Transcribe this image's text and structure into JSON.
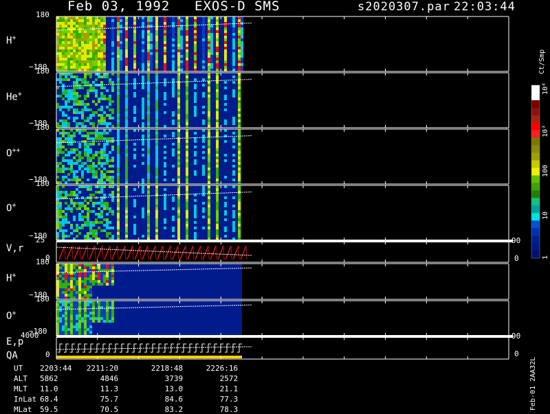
{
  "header": {
    "date": "Feb 03, 1992",
    "instrument": "EXOS-D SMS",
    "file": "s2020307.par",
    "time": "22:03:44"
  },
  "panels": [
    {
      "label": "H",
      "sup": "+",
      "ytop": "180",
      "ybot": "−180"
    },
    {
      "label": "He",
      "sup": "+",
      "ytop": "180",
      "ybot": "−180"
    },
    {
      "label": "O",
      "sup": "++",
      "ytop": "180",
      "ybot": "−180"
    },
    {
      "label": "O",
      "sup": "+",
      "ytop": "180",
      "ybot": "−180"
    },
    {
      "label": "V,r",
      "sup": "",
      "ytop": "25",
      "ybot": "0",
      "rtop": "90",
      "rbot": "0"
    },
    {
      "label": "H",
      "sup": "+",
      "ytop": "180",
      "ybot": "−180"
    },
    {
      "label": "O",
      "sup": "+",
      "ytop": "180",
      "ybot": "−180"
    },
    {
      "label": "E,p",
      "sub": "QA",
      "ytop": "4000",
      "ybot": "0",
      "rtop": "90",
      "rbot": "0"
    }
  ],
  "colorbar": {
    "unit": "Ct/Smp",
    "ticks": [
      "10⁴",
      "10³",
      "100",
      "10",
      "1"
    ],
    "colors": [
      "#ffffff",
      "#ffffff",
      "#7a0000",
      "#8c1010",
      "#a82010",
      "#ff0000",
      "#ff2020",
      "#7a7a00",
      "#8a8a10",
      "#a0a000",
      "#c8c800",
      "#f0f000",
      "#60c000",
      "#40a000",
      "#208000",
      "#10c080",
      "#00a0a0",
      "#00e0e0",
      "#0050d0",
      "#0030b0",
      "#002090",
      "#001880",
      "#001070"
    ]
  },
  "side_label": "Feb-01 2AA32L",
  "orbit_table": {
    "rows": [
      {
        "name": "UT",
        "values": [
          "2203:44",
          "2211:20",
          "2218:48",
          "2226:16"
        ]
      },
      {
        "name": "ALT",
        "values": [
          "5862",
          "4846",
          "3739",
          "2572"
        ]
      },
      {
        "name": "MLT",
        "values": [
          "11.0",
          "11.3",
          "13.0",
          "21.1"
        ]
      },
      {
        "name": "InLat",
        "values": [
          "68.4",
          "75.7",
          "84.6",
          "77.3"
        ]
      },
      {
        "name": "MLat",
        "values": [
          "59.5",
          "70.5",
          "83.2",
          "78.3"
        ]
      }
    ]
  },
  "chart_data": {
    "type": "heatmap",
    "title": "Feb 03, 1992  EXOS-D SMS",
    "x_ticks_ut": [
      "2203:44",
      "2211:20",
      "2218:48",
      "2226:16"
    ],
    "y_range_pitch": [
      -180,
      180
    ],
    "series": [
      {
        "name": "H+",
        "data_end_fraction": 0.59
      },
      {
        "name": "He+",
        "data_end_fraction": 0.59
      },
      {
        "name": "O++",
        "data_end_fraction": 0.59
      },
      {
        "name": "O+",
        "data_end_fraction": 0.59
      },
      {
        "name": "V,r",
        "data_end_fraction": 0.59
      },
      {
        "name": "H+ (lower)",
        "data_end_fraction": 0.59
      },
      {
        "name": "O+ (lower)",
        "data_end_fraction": 0.59
      },
      {
        "name": "E,p / QA",
        "data_end_fraction": 0.59
      }
    ],
    "color_scale": "log",
    "color_range_counts": [
      1,
      10000
    ],
    "color_unit": "Ct/Smp"
  }
}
